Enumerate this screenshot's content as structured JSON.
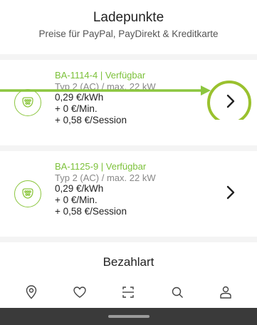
{
  "header": {
    "title": "Ladepunkte",
    "subtitle": "Preise für PayPal, PayDirekt & Kreditkarte"
  },
  "chargers": [
    {
      "status": "BA-1114-4 | Verfügbar",
      "spec": "Typ 2 (AC) / max. 22 kW",
      "price_kwh": "0,29 €/kWh",
      "price_min": "+ 0 €/Min.",
      "price_session": "+ 0,58 €/Session"
    },
    {
      "status": "BA-1125-9 | Verfügbar",
      "spec": "Typ 2 (AC) / max. 22 kW",
      "price_kwh": "0,29 €/kWh",
      "price_min": "+ 0 €/Min.",
      "price_session": "+ 0,58 €/Session"
    }
  ],
  "section": {
    "label": "Bezahlart"
  },
  "tabbar": {
    "items": [
      {
        "icon": "map-pin-icon"
      },
      {
        "icon": "heart-icon"
      },
      {
        "icon": "scan-icon"
      },
      {
        "icon": "search-icon"
      },
      {
        "icon": "user-icon"
      }
    ]
  },
  "colors": {
    "accent": "#8cc63f",
    "status_text": "#7cc13a",
    "nav_bar": "#3a3a3a"
  }
}
